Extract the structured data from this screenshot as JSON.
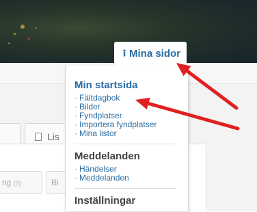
{
  "header": {
    "mina_sidor_label": "Mina sidor",
    "person_icon": "person-icon"
  },
  "tabs": {
    "list_tab_label": "Lis",
    "list_tab_icon": "document-icon"
  },
  "sub_tabs": {
    "first_label": "ng",
    "first_count": "(0)",
    "second_label": "Bi"
  },
  "menu": {
    "startsida": {
      "heading": "Min startsida",
      "items": [
        "Fältdagbok",
        "Bilder",
        "Fyndplatser",
        "Importera fyndplatser",
        "Mina listor"
      ]
    },
    "meddelanden": {
      "heading": "Meddelanden",
      "items": [
        "Händelser",
        "Meddelanden"
      ]
    },
    "installningar": {
      "heading": "Inställningar"
    },
    "bullet": "·"
  },
  "annotation": {
    "arrow_color": "#e02020"
  }
}
